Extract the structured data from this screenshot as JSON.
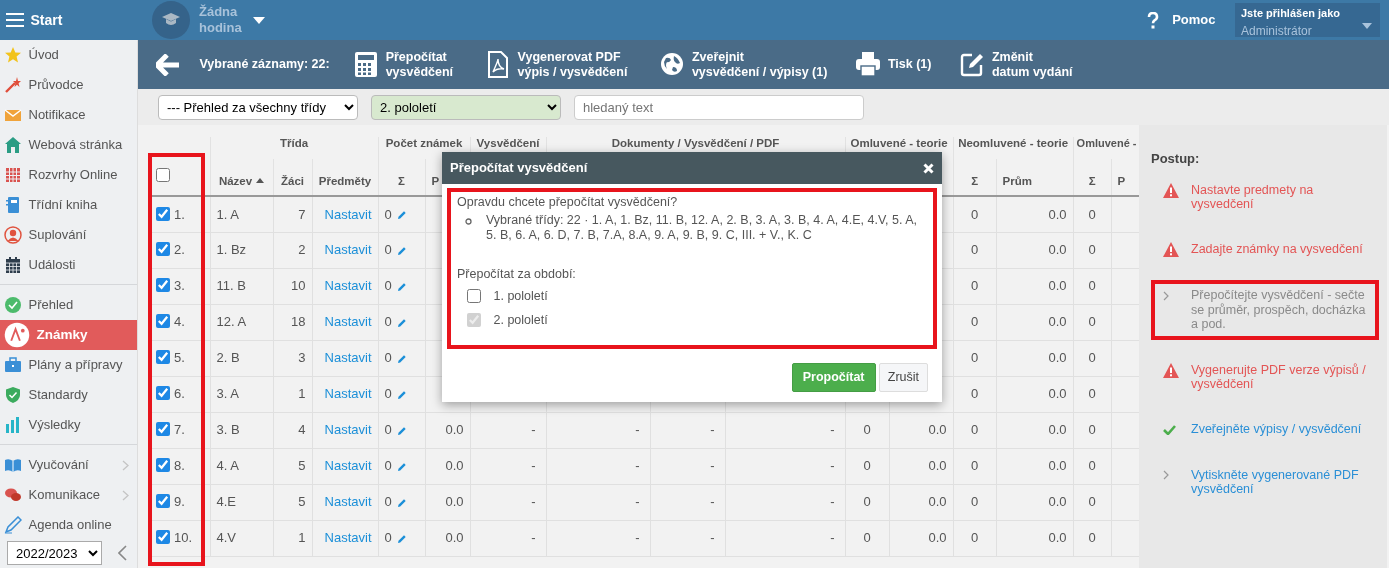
{
  "topbar": {
    "menu_label": "Start",
    "lesson": "Žádna hodina",
    "help": "Pomoc",
    "user_caption": "Jste přihlášen jako",
    "user_role": "Administrátor"
  },
  "sidebar": {
    "sections": [
      [
        {
          "label": "Úvod",
          "selected": false,
          "submenu": false
        },
        {
          "label": "Průvodce",
          "selected": false,
          "submenu": false
        },
        {
          "label": "Notifikace",
          "selected": false,
          "submenu": false
        },
        {
          "label": "Webová stránka",
          "selected": false,
          "submenu": false
        },
        {
          "label": "Rozvrhy Online",
          "selected": false,
          "submenu": false
        },
        {
          "label": "Třídní kniha",
          "selected": false,
          "submenu": false
        },
        {
          "label": "Suplování",
          "selected": false,
          "submenu": false
        },
        {
          "label": "Události",
          "selected": false,
          "submenu": false
        }
      ],
      [
        {
          "label": "Přehled",
          "selected": false,
          "submenu": false
        },
        {
          "label": "Známky",
          "selected": true,
          "submenu": false
        },
        {
          "label": "Plány a přípravy",
          "selected": false,
          "submenu": false
        },
        {
          "label": "Standardy",
          "selected": false,
          "submenu": false
        },
        {
          "label": "Výsledky",
          "selected": false,
          "submenu": false
        }
      ],
      [
        {
          "label": "Vyučování",
          "selected": false,
          "submenu": true
        },
        {
          "label": "Komunikace",
          "selected": false,
          "submenu": true
        },
        {
          "label": "Agenda online",
          "selected": false,
          "submenu": false
        }
      ]
    ],
    "year": "2022/2023"
  },
  "toolbar": {
    "selected_caption": "Vybrané záznamy: 22:",
    "actions": [
      {
        "lines": [
          "Přepočítat",
          "vysvědčení"
        ]
      },
      {
        "lines": [
          "Vygenerovat PDF",
          "výpis / vysvědčení"
        ]
      },
      {
        "lines": [
          "Zveřejnit",
          "vysvědčení / výpisy (1)"
        ]
      },
      {
        "lines": [
          "Tisk (1)"
        ]
      },
      {
        "lines": [
          "Změnit",
          "datum vydání"
        ]
      }
    ]
  },
  "filters": {
    "class_select": "--- Přehled za všechny třídy",
    "period_select": "2. pololetí",
    "search": {
      "placeholder": "hledaný text"
    }
  },
  "table": {
    "checkbox_column_highlighted": true,
    "select_all_checked": false,
    "groups": [
      {
        "label": "Třída",
        "columns": [
          {
            "label": "Název",
            "kind": "name",
            "sorted": true
          },
          {
            "label": "Žáci",
            "kind": "number"
          },
          {
            "label": "Předměty",
            "kind": "link"
          }
        ]
      },
      {
        "label": "Počet známek",
        "columns": [
          {
            "label": "Σ",
            "kind": "edit"
          },
          {
            "label": "P",
            "kind": "decimal"
          }
        ]
      },
      {
        "label": "Vysvědčení",
        "columns": [
          {
            "kind": "dash"
          }
        ]
      },
      {
        "label": "Dokumenty / Vysvědčení / PDF",
        "columns": [
          {
            "kind": "dash"
          },
          {
            "kind": "dash"
          },
          {
            "kind": "dash"
          }
        ]
      },
      {
        "label": "Omluvené - teorie",
        "columns": [
          {
            "kind": "count"
          },
          {
            "kind": "decimal"
          }
        ]
      },
      {
        "label": "Neomluvené - teorie",
        "columns": [
          {
            "label": "Σ",
            "kind": "count"
          },
          {
            "label": "Prům",
            "kind": "decimal"
          }
        ]
      },
      {
        "label": "Omluvené -",
        "columns": [
          {
            "label": "Σ",
            "kind": "count"
          },
          {
            "label": "P",
            "kind": "decimal"
          }
        ]
      }
    ],
    "rows": [
      {
        "number": "1.",
        "checked": true,
        "cells": [
          "1. A",
          "7",
          "Nastavit",
          "0",
          null,
          null,
          null,
          null,
          null,
          null,
          null,
          "0",
          "0.0",
          "0",
          null
        ]
      },
      {
        "number": "2.",
        "checked": true,
        "cells": [
          "1. Bz",
          "2",
          "Nastavit",
          "0",
          null,
          null,
          null,
          null,
          null,
          null,
          null,
          "0",
          "0.0",
          "0",
          null
        ]
      },
      {
        "number": "3.",
        "checked": true,
        "cells": [
          "11. B",
          "10",
          "Nastavit",
          "0",
          null,
          null,
          null,
          null,
          null,
          null,
          null,
          "0",
          "0.0",
          "0",
          null
        ]
      },
      {
        "number": "4.",
        "checked": true,
        "cells": [
          "12. A",
          "18",
          "Nastavit",
          "0",
          null,
          null,
          null,
          null,
          null,
          null,
          null,
          "0",
          "0.0",
          "0",
          null
        ]
      },
      {
        "number": "5.",
        "checked": true,
        "cells": [
          "2. B",
          "3",
          "Nastavit",
          "0",
          null,
          null,
          null,
          null,
          null,
          null,
          null,
          "0",
          "0.0",
          "0",
          null
        ]
      },
      {
        "number": "6.",
        "checked": true,
        "cells": [
          "3. A",
          "1",
          "Nastavit",
          "0",
          null,
          null,
          null,
          null,
          null,
          null,
          null,
          "0",
          "0.0",
          "0",
          null
        ]
      },
      {
        "number": "7.",
        "checked": true,
        "cells": [
          "3. B",
          "4",
          "Nastavit",
          "0",
          "0.0",
          "-",
          "-",
          "-",
          "-",
          "0",
          "0.0",
          "0",
          "0.0",
          "0",
          null
        ]
      },
      {
        "number": "8.",
        "checked": true,
        "cells": [
          "4. A",
          "5",
          "Nastavit",
          "0",
          "0.0",
          "-",
          "-",
          "-",
          "-",
          "0",
          "0.0",
          "0",
          "0.0",
          "0",
          null
        ]
      },
      {
        "number": "9.",
        "checked": true,
        "cells": [
          "4.E",
          "5",
          "Nastavit",
          "0",
          "0.0",
          "-",
          "-",
          "-",
          "-",
          "0",
          "0.0",
          "0",
          "0.0",
          "0",
          null
        ]
      },
      {
        "number": "10.",
        "checked": true,
        "cells": [
          "4.V",
          "1",
          "Nastavit",
          "0",
          "0.0",
          "-",
          "-",
          "-",
          "-",
          "0",
          "0.0",
          "0",
          "0.0",
          "0",
          null
        ]
      }
    ]
  },
  "dialog": {
    "title": "Přepočítat vysvědčení",
    "highlighted": true,
    "question": "Opravdu chcete přepočítat vysvědčení?",
    "details": [
      "Vybrané třídy: 22 · 1. A, 1. Bz, 11. B, 12. A, 2. B, 3. A, 3. B, 4. A, 4.E, 4.V, 5. A, 5. B, 6. A, 6. D, 7. B, 7.A, 8.A, 9. A, 9. B, 9. C, III. + V., K. C"
    ],
    "period_label": "Přepočítat za období:",
    "periods": [
      {
        "label": "1. pololetí",
        "checked": false,
        "disabled": false
      },
      {
        "label": "2. pololetí",
        "checked": true,
        "disabled": true
      }
    ],
    "confirm": "Propočítat",
    "cancel": "Zrušit"
  },
  "steps_panel": {
    "title": "Postup:",
    "steps": [
      {
        "kind": "warning",
        "text": "Nastavte predmety na vysvedčení",
        "highlighted": false
      },
      {
        "kind": "warning",
        "text": "Zadajte známky na vysvedčení",
        "highlighted": false
      },
      {
        "kind": "pending",
        "text": "Přepočítejte vysvědčení - sečte se průměr, prospěch, docházka a pod.",
        "highlighted": true
      },
      {
        "kind": "warning",
        "text": "Vygenerujte PDF verze výpisů / vysvědčení",
        "highlighted": false
      },
      {
        "kind": "done",
        "text": "Zveřejněte výpisy / vysvědčení",
        "highlighted": false
      },
      {
        "kind": "todo",
        "text": "Vytiskněte vygenerované PDF vysvědčení",
        "highlighted": false
      }
    ]
  }
}
